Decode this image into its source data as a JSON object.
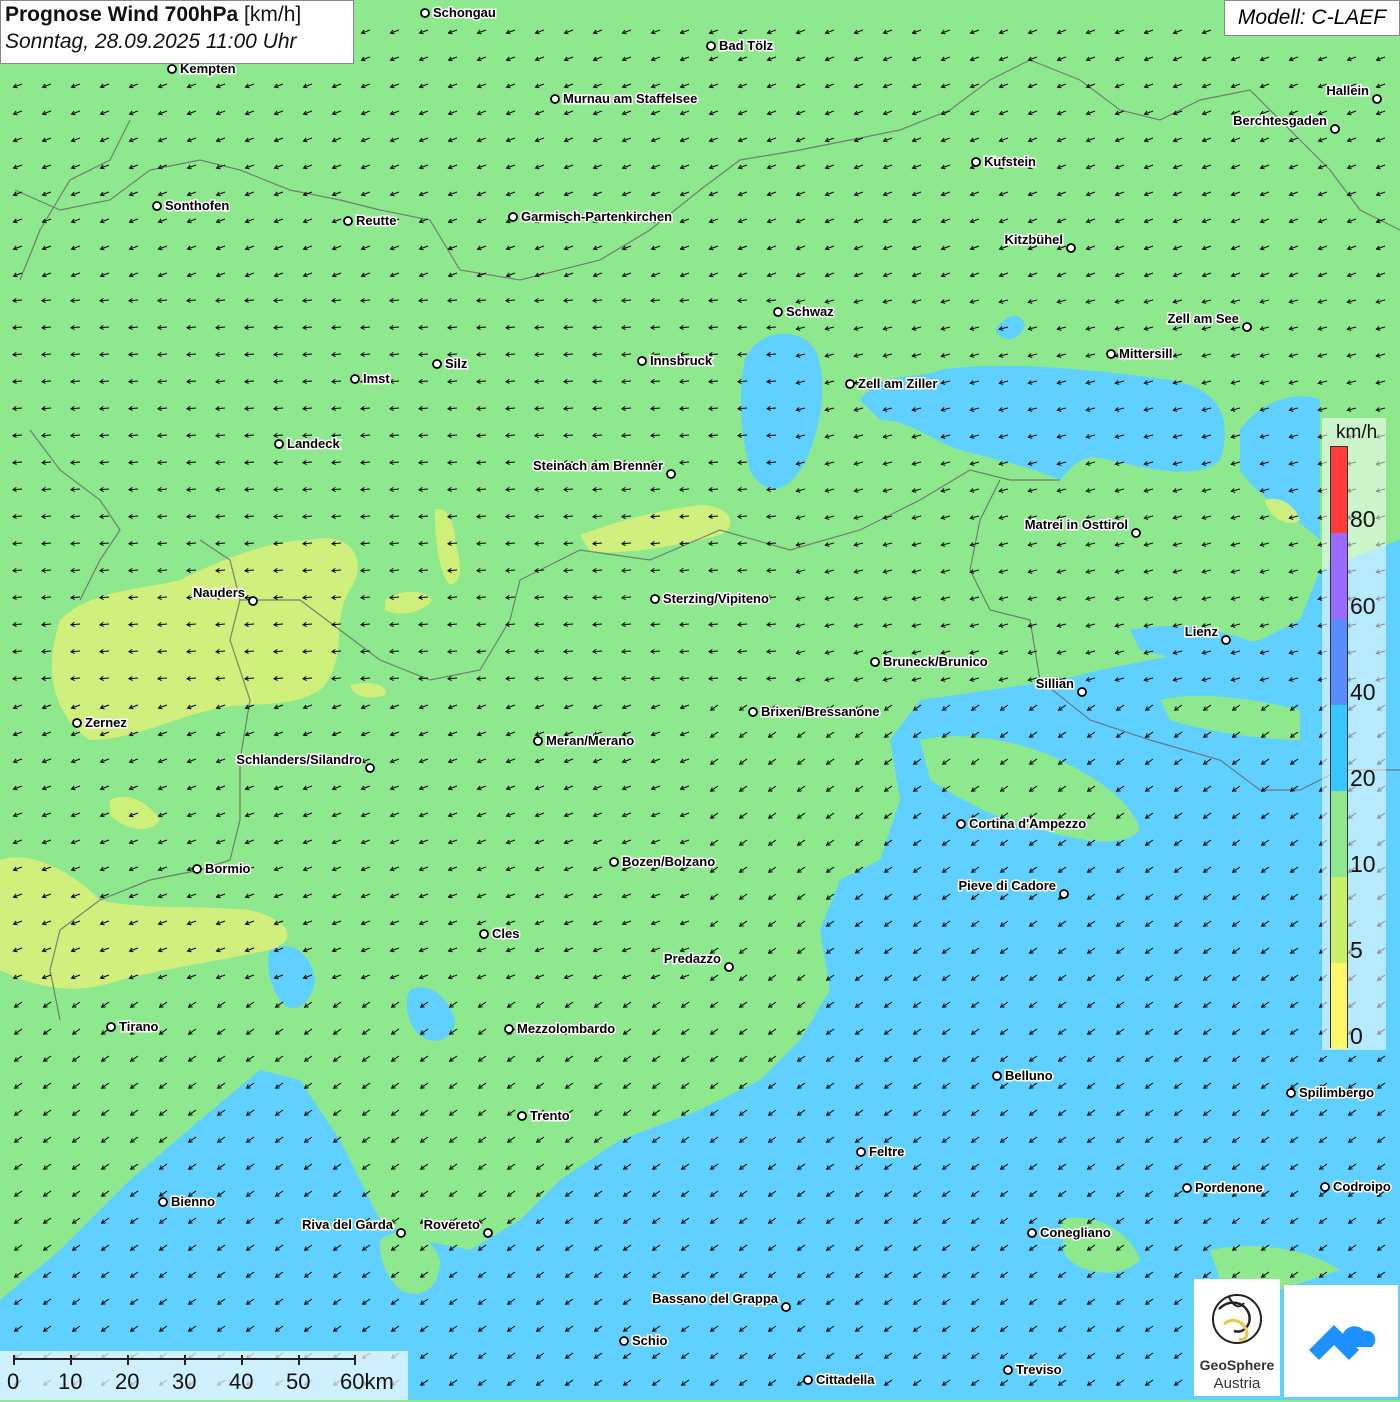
{
  "title": {
    "main": "Prognose Wind 700hPa",
    "unit": "[km/h]",
    "date": "Sonntag, 28.09.2025 11:00 Uhr"
  },
  "model": "Modell: C-LAEF",
  "legend": {
    "unit": "km/h",
    "labels": [
      "80",
      "60",
      "40",
      "20",
      "10",
      "5",
      "0"
    ],
    "colors": [
      "#ff3b3b",
      "#9b6bff",
      "#5b8cff",
      "#35c8ff",
      "#8ee88e",
      "#c9f06b",
      "#fff76b"
    ]
  },
  "scale": {
    "labels": [
      "0",
      "10",
      "20",
      "30",
      "40",
      "50",
      "60km"
    ]
  },
  "logos": {
    "primary_line1": "GeoSphere",
    "primary_line2": "Austria"
  },
  "colors": {
    "green": "#8ee88e",
    "blue": "#5fd0ff",
    "yellow": "#d7f07a"
  },
  "cities": [
    {
      "name": "Schongau"
    },
    {
      "name": "Bad Tölz"
    },
    {
      "name": "Kempten"
    },
    {
      "name": "Murnau am Staffelsee"
    },
    {
      "name": "Hallein"
    },
    {
      "name": "Berchtesgaden"
    },
    {
      "name": "Kufstein"
    },
    {
      "name": "Sonthofen"
    },
    {
      "name": "Reutte"
    },
    {
      "name": "Garmisch-Partenkirchen"
    },
    {
      "name": "Kitzbühel"
    },
    {
      "name": "Schwaz"
    },
    {
      "name": "Zell am See"
    },
    {
      "name": "Mittersill"
    },
    {
      "name": "Innsbruck"
    },
    {
      "name": "Silz"
    },
    {
      "name": "Imst"
    },
    {
      "name": "Zell am Ziller"
    },
    {
      "name": "Landeck"
    },
    {
      "name": "Steinach am Brenner"
    },
    {
      "name": "Matrei in Osttirol"
    },
    {
      "name": "Nauders"
    },
    {
      "name": "Sterzing/Vipiteno"
    },
    {
      "name": "Lienz"
    },
    {
      "name": "Bruneck/Brunico"
    },
    {
      "name": "Sillian"
    },
    {
      "name": "Brixen/Bressanone"
    },
    {
      "name": "Zernez"
    },
    {
      "name": "Meran/Merano"
    },
    {
      "name": "Schlanders/Silandro"
    },
    {
      "name": "Cortina d'Ampezzo"
    },
    {
      "name": "Bozen/Bolzano"
    },
    {
      "name": "Bormio"
    },
    {
      "name": "Pieve di Cadore"
    },
    {
      "name": "Cles"
    },
    {
      "name": "Predazzo"
    },
    {
      "name": "Tirano"
    },
    {
      "name": "Mezzolombardo"
    },
    {
      "name": "Belluno"
    },
    {
      "name": "Spilimbergo"
    },
    {
      "name": "Trento"
    },
    {
      "name": "Feltre"
    },
    {
      "name": "Pordenone"
    },
    {
      "name": "Codroipo"
    },
    {
      "name": "Bienno"
    },
    {
      "name": "Riva del Garda"
    },
    {
      "name": "Rovereto"
    },
    {
      "name": "Conegliano"
    },
    {
      "name": "Bassano del Grappa"
    },
    {
      "name": "Schio"
    },
    {
      "name": "Treviso"
    },
    {
      "name": "Cittadella"
    }
  ]
}
